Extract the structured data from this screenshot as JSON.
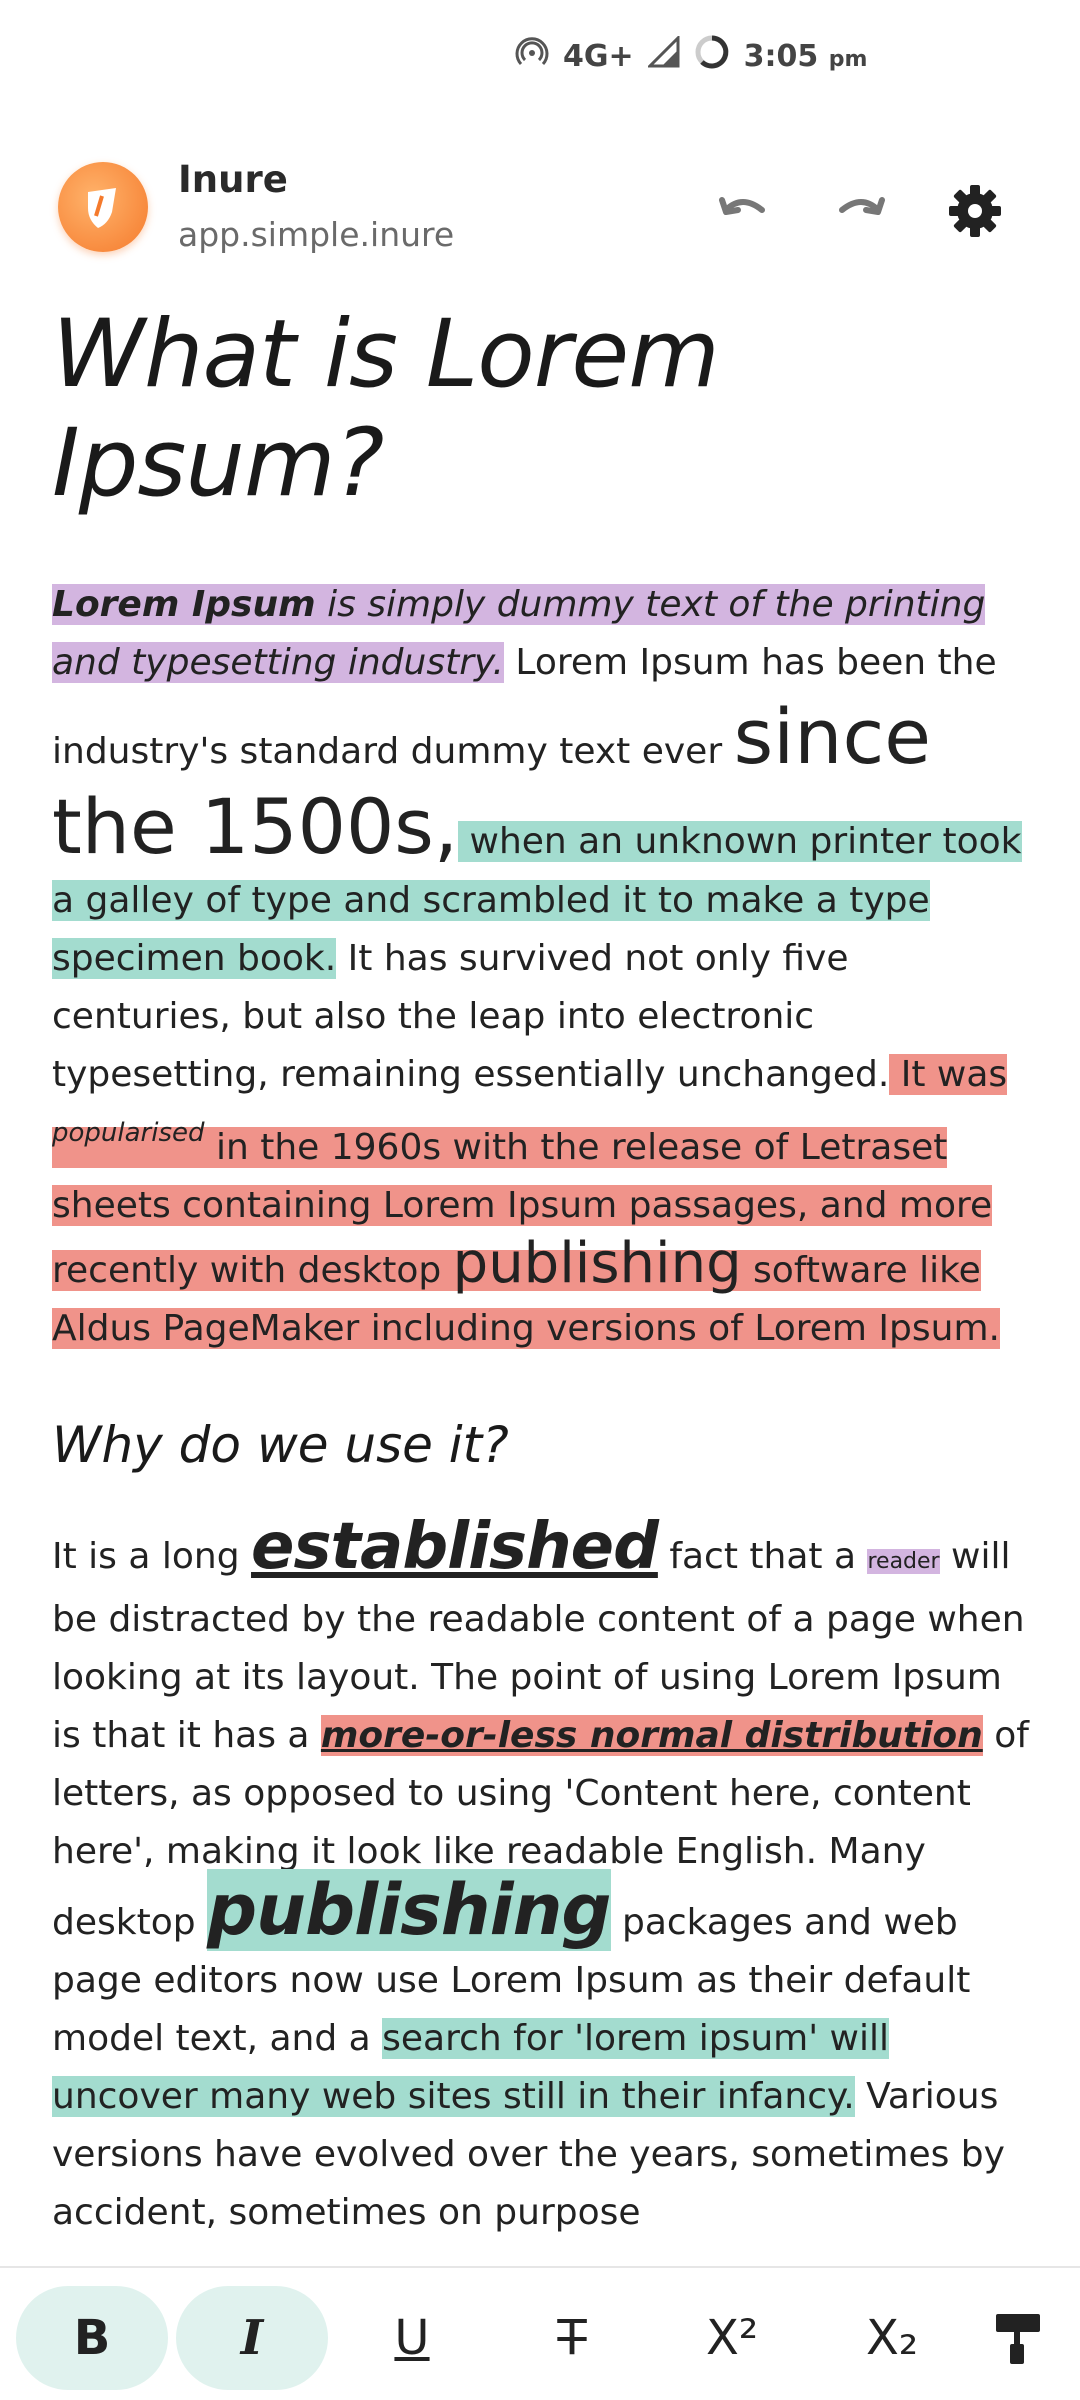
{
  "status_bar": {
    "network": "4G+",
    "time": "3:05",
    "ampm": "pm"
  },
  "header": {
    "app_name": "Inure",
    "package": "app.simple.inure",
    "icons": [
      "app-logo-icon",
      "undo-icon",
      "redo-icon",
      "settings-icon"
    ]
  },
  "document": {
    "title": "What is Lorem Ipsum?",
    "p1": {
      "s1_bold": "Lorem Ipsum",
      "s1_rest": " is simply dummy text of the printing and typesetting industry.",
      "s2": " Lorem Ipsum has been the industry's standard dummy text ever ",
      "s3_big": "since the 1500s,",
      "s4": " when an unknown printer took a galley of type and scrambled it to make a type specimen book.",
      "s5": " It has survived not only five centuries, but also the leap into electronic typesetting, remaining essentially unchanged.",
      "s6a": " It was ",
      "s6b": "popularised",
      "s6c": " in the 1960s with the release of Letraset sheets containing Lorem Ipsum passages, and more recently with desktop ",
      "s6d": "publishing",
      "s6e": " software like Aldus PageMaker including versions of Lorem Ipsum."
    },
    "heading2": "Why do we use it?",
    "p2": {
      "a": "It is a long ",
      "b": "established",
      "c": " fact that a ",
      "d": "reader",
      "e": " will be distracted by the readable content of a page when looking at its layout. The point of using Lorem Ipsum is that it has a ",
      "f": "more-or-less normal distribution",
      "g": " of letters, as opposed to using 'Content here, content here', making it look like readable English. Many desktop ",
      "h": "publishing",
      "i": " packages and web page editors now use Lorem Ipsum as their default model text, and a ",
      "j": "search for 'lorem ipsum' will uncover many web sites still in their infancy.",
      "k": " Various versions have evolved over the years, sometimes by accident, sometimes on purpose"
    }
  },
  "toolbar": {
    "bold": "B",
    "italic": "I",
    "underline": "U",
    "strike": "T",
    "superscript": "X²",
    "subscript": "X₂"
  },
  "colors": {
    "purple_highlight": "#d3b5e0",
    "teal_highlight": "#a3dccf",
    "red_highlight": "#f0938a",
    "active_button": "#e0f2ee"
  }
}
